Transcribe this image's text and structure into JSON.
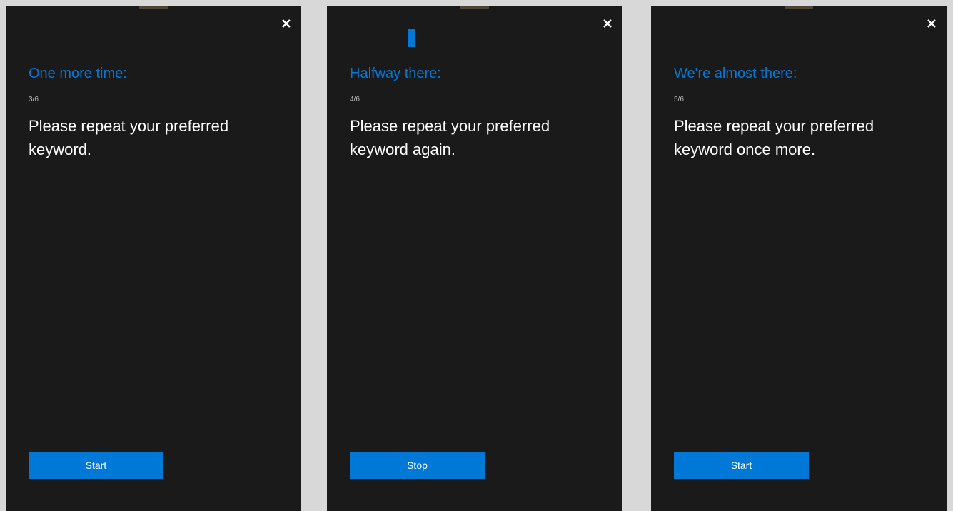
{
  "colors": {
    "accent": "#0078d7",
    "panel_background": "#1a1a1b",
    "page_background": "#d8d8d8",
    "text_primary": "#ffffff",
    "text_secondary": "#b8b8b8"
  },
  "panels": [
    {
      "heading": "One more time:",
      "step": "3/6",
      "instruction": "Please repeat your preferred keyword.",
      "button_label": "Start",
      "close_icon": "close-icon",
      "listening": false
    },
    {
      "heading": "Halfway there:",
      "step": "4/6",
      "instruction": "Please repeat your preferred keyword again.",
      "button_label": "Stop",
      "close_icon": "close-icon",
      "listening": true
    },
    {
      "heading": "We're almost there:",
      "step": "5/6",
      "instruction": "Please repeat your preferred keyword once more.",
      "button_label": "Start",
      "close_icon": "close-icon",
      "listening": false
    }
  ]
}
